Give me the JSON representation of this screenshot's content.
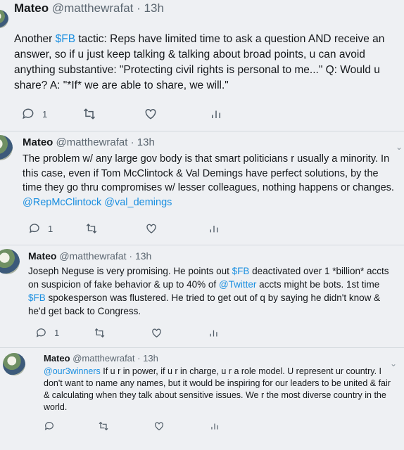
{
  "tweets": [
    {
      "name": "Mateo",
      "handle": "@matthewrafat",
      "separator": "·",
      "time": "13h",
      "parts": [
        {
          "text": "Another ",
          "link": false
        },
        {
          "text": "$FB",
          "link": true
        },
        {
          "text": " tactic: Reps have limited time to ask a question AND receive an answer, so if u just keep talking & talking about broad points, u can avoid anything substantive: \"Protecting civil rights is personal to me...\" Q: Would u share? A: \"*If* we are able to share, we will.\"",
          "link": false
        }
      ],
      "reply_count": "1"
    },
    {
      "name": "Mateo",
      "handle": "@matthewrafat",
      "separator": "·",
      "time": "13h",
      "parts": [
        {
          "text": "The problem w/ any large gov body is that smart politicians r usually a minority. In this case, even if Tom McClintock & Val Demings have perfect solutions, by the time they go thru compromises w/ lesser colleagues, nothing happens or changes. ",
          "link": false
        },
        {
          "text": "@RepMcClintock",
          "link": true
        },
        {
          "text": " ",
          "link": false
        },
        {
          "text": "@val_demings",
          "link": true
        }
      ],
      "reply_count": "1"
    },
    {
      "name": "Mateo",
      "handle": "@matthewrafat",
      "separator": "·",
      "time": "13h",
      "parts": [
        {
          "text": "Joseph Neguse is very promising. He points out ",
          "link": false
        },
        {
          "text": "$FB",
          "link": true
        },
        {
          "text": " deactivated over 1 *billion* accts on suspicion of fake behavior & up to 40% of ",
          "link": false
        },
        {
          "text": "@Twitter",
          "link": true
        },
        {
          "text": " accts might be bots. 1st time ",
          "link": false
        },
        {
          "text": "$FB",
          "link": true
        },
        {
          "text": " spokesperson was flustered. He tried to get out of q by saying he didn't know & he'd get back to Congress.",
          "link": false
        }
      ],
      "reply_count": "1"
    },
    {
      "name": "Mateo",
      "handle": "@matthewrafat",
      "separator": "·",
      "time": "13h",
      "parts": [
        {
          "text": "@our3winners",
          "link": true
        },
        {
          "text": " If u r in power, if u r in charge, u r a role model. U represent ur country. I don't want to name any names, but it would be inspiring for our leaders to be united & fair & calculating when they talk about sensitive issues. We r the most diverse country in the world.",
          "link": false
        }
      ],
      "reply_count": ""
    }
  ],
  "colors": {
    "link": "#1b8fe0",
    "muted": "#5b6670",
    "background": "#eef0f3"
  },
  "icons": [
    "reply-icon",
    "retweet-icon",
    "like-icon",
    "analytics-icon",
    "chevron-down-icon"
  ]
}
